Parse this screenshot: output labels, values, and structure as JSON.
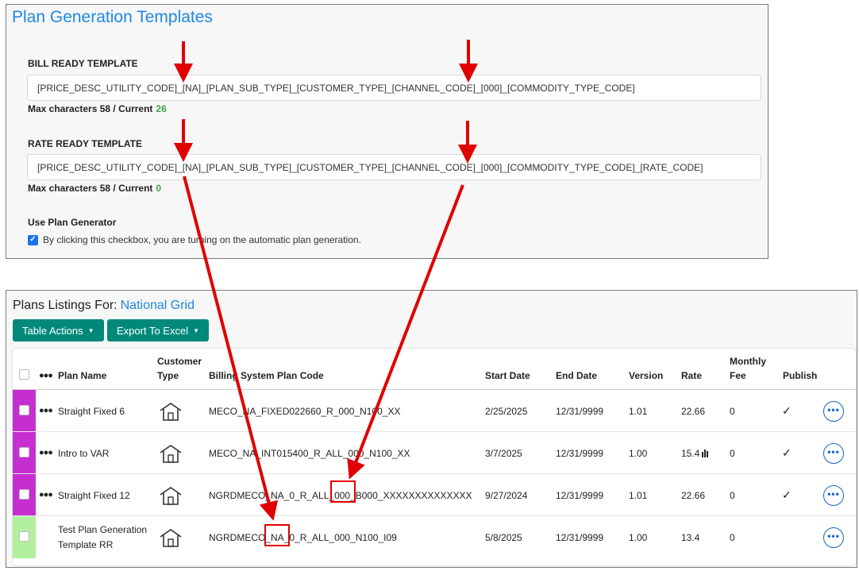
{
  "templates": {
    "title": "Plan Generation Templates",
    "bill": {
      "label": "BILL READY TEMPLATE",
      "value": "[PRICE_DESC_UTILITY_CODE]_[NA]_[PLAN_SUB_TYPE]_[CUSTOMER_TYPE]_[CHANNEL_CODE]_[000]_[COMMODITY_TYPE_CODE]",
      "max_label": "Max characters 58 / Current",
      "current": "26"
    },
    "rate": {
      "label": "RATE READY TEMPLATE",
      "value": "[PRICE_DESC_UTILITY_CODE]_[NA]_[PLAN_SUB_TYPE]_[CUSTOMER_TYPE]_[CHANNEL_CODE]_[000]_[COMMODITY_TYPE_CODE]_[RATE_CODE]",
      "max_label": "Max characters 58 / Current",
      "current": "0"
    },
    "generator": {
      "label": "Use Plan Generator",
      "checkbox_text": "By clicking this checkbox, you are turning on the automatic plan generation.",
      "checked": true
    }
  },
  "plans": {
    "heading_prefix": "Plans Listings For:",
    "provider": "National Grid",
    "buttons": {
      "table_actions": "Table Actions",
      "export": "Export To Excel"
    },
    "columns": {
      "plan_name": "Plan Name",
      "customer": "Customer",
      "type": "Type",
      "billing": "Billing System Plan Code",
      "start": "Start Date",
      "end": "End Date",
      "version": "Version",
      "rate": "Rate",
      "monthly": "Monthly",
      "fee": "Fee",
      "publish": "Publish"
    },
    "rows": [
      {
        "color": "#c62fcf",
        "name": "Straight Fixed 6",
        "name2": "",
        "code": "MECO_NA_FIXED022660_R_000_N100_XX",
        "start": "2/25/2025",
        "end": "12/31/9999",
        "version": "1.01",
        "rate": "22.66",
        "fee": "0",
        "published": "✓"
      },
      {
        "color": "#c62fcf",
        "name": "Intro to VAR",
        "name2": "",
        "code": "MECO_NA_INT015400_R_ALL_000_N100_XX",
        "start": "3/7/2025",
        "end": "12/31/9999",
        "version": "1.00",
        "rate": "15.4",
        "fee": "0",
        "published": "✓"
      },
      {
        "color": "#c62fcf",
        "name": "Straight Fixed 12",
        "name2": "",
        "code": "NGRDMECO_NA_0_R_ALL_000_B000_XXXXXXXXXXXXXX",
        "start": "9/27/2024",
        "end": "12/31/9999",
        "version": "1.01",
        "rate": "22.66",
        "fee": "0",
        "published": "✓"
      },
      {
        "color": "#b2f0a0",
        "name": "Test Plan Generation",
        "name2": "Template RR",
        "code": "NGRDMECO_NA_0_R_ALL_000_N100_I09",
        "start": "5/8/2025",
        "end": "12/31/9999",
        "version": "1.00",
        "rate": "13.4",
        "fee": "0",
        "published": ""
      }
    ]
  },
  "colors": {
    "accent_blue": "#1e88e5",
    "button_teal": "#00897b",
    "annotation_red": "#e00000",
    "row_purple": "#c62fcf",
    "row_green": "#b2f0a0"
  }
}
